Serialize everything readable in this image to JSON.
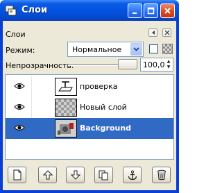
{
  "window": {
    "title": "Слои"
  },
  "panel": {
    "label": "Слои"
  },
  "mode": {
    "label": "Режим:",
    "value": "Нормальное"
  },
  "opacity": {
    "label": "Непрозрачность:",
    "value": "100,0",
    "fraction": 1.0
  },
  "layers": [
    {
      "name": "проверка",
      "visible": true,
      "thumbnail": "text-layer-icon",
      "selected": false
    },
    {
      "name": "Новый слой",
      "visible": true,
      "thumbnail": "transparent-checker",
      "selected": false
    },
    {
      "name": "Background",
      "visible": true,
      "thumbnail": "image-thumbnail",
      "selected": true
    }
  ],
  "toolbar": {
    "buttons": [
      "new-layer-icon",
      "raise-layer-icon",
      "lower-layer-icon",
      "duplicate-layer-icon",
      "anchor-layer-icon",
      "delete-layer-icon"
    ]
  },
  "colors": {
    "title_bar": "#0451e0",
    "selection": "#316ac5",
    "client_bg": "#ece9d8"
  }
}
